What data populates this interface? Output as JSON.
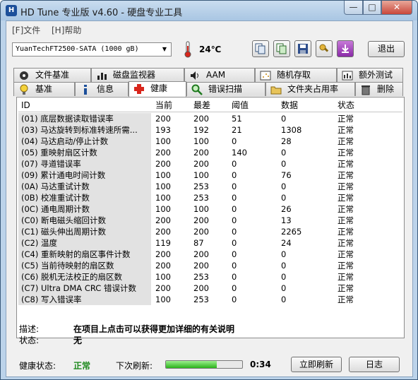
{
  "window": {
    "app_icon_text": "H",
    "title": "HD Tune 专业版 v4.60 - 硬盘专业工具",
    "controls": {
      "minimize": "—",
      "maximize": "□",
      "close": "✕"
    }
  },
  "menu": [
    {
      "label": "[F]文件"
    },
    {
      "label": "[H]帮助"
    }
  ],
  "toolbar": {
    "drive": "YuanTechFT2500-SATA          (1000 gB)",
    "temperature": "24℃",
    "buttons": [
      "copy-icon",
      "copy-info-icon",
      "save-icon",
      "options-icon",
      "download-icon"
    ],
    "exit_label": "退出"
  },
  "tabs_top": [
    {
      "label": "文件基准",
      "icon": "file-benchmark-icon"
    },
    {
      "label": "磁盘监视器",
      "icon": "disk-monitor-icon"
    },
    {
      "label": "AAM",
      "icon": "speaker-icon"
    },
    {
      "label": "随机存取",
      "icon": "random-access-icon"
    },
    {
      "label": "额外测试",
      "icon": "extra-tests-icon"
    }
  ],
  "tabs_bottom": [
    {
      "label": "基准",
      "icon": "bulb-icon"
    },
    {
      "label": "信息",
      "icon": "info-icon"
    },
    {
      "label": "健康",
      "icon": "health-cross-icon",
      "active": true
    },
    {
      "label": "错误扫描",
      "icon": "magnifier-icon"
    },
    {
      "label": "文件夹占用率",
      "icon": "folder-icon"
    },
    {
      "label": "删除",
      "icon": "trash-icon"
    }
  ],
  "table": {
    "headers": [
      "ID",
      "当前",
      "最差",
      "阈值",
      "数据",
      "状态"
    ],
    "rows": [
      {
        "id": "(01) 底层数据读取错误率",
        "current": "200",
        "worst": "200",
        "threshold": "51",
        "data": "0",
        "status": "正常"
      },
      {
        "id": "(03) 马达旋转到标准转速所需...",
        "current": "193",
        "worst": "192",
        "threshold": "21",
        "data": "1308",
        "status": "正常"
      },
      {
        "id": "(04) 马达启动/停止计数",
        "current": "100",
        "worst": "100",
        "threshold": "0",
        "data": "28",
        "status": "正常"
      },
      {
        "id": "(05) 重映射扇区计数",
        "current": "200",
        "worst": "200",
        "threshold": "140",
        "data": "0",
        "status": "正常"
      },
      {
        "id": "(07) 寻道错误率",
        "current": "200",
        "worst": "200",
        "threshold": "0",
        "data": "0",
        "status": "正常"
      },
      {
        "id": "(09) 累计通电时间计数",
        "current": "100",
        "worst": "100",
        "threshold": "0",
        "data": "76",
        "status": "正常"
      },
      {
        "id": "(0A) 马达重试计数",
        "current": "100",
        "worst": "253",
        "threshold": "0",
        "data": "0",
        "status": "正常"
      },
      {
        "id": "(0B) 校准重试计数",
        "current": "100",
        "worst": "253",
        "threshold": "0",
        "data": "0",
        "status": "正常"
      },
      {
        "id": "(0C) 通电周期计数",
        "current": "100",
        "worst": "100",
        "threshold": "0",
        "data": "26",
        "status": "正常"
      },
      {
        "id": "(C0) 断电磁头缩回计数",
        "current": "200",
        "worst": "200",
        "threshold": "0",
        "data": "13",
        "status": "正常"
      },
      {
        "id": "(C1) 磁头伸出周期计数",
        "current": "200",
        "worst": "200",
        "threshold": "0",
        "data": "2265",
        "status": "正常"
      },
      {
        "id": "(C2) 温度",
        "current": "119",
        "worst": "87",
        "threshold": "0",
        "data": "24",
        "status": "正常"
      },
      {
        "id": "(C4) 重新映射的扇区事件计数",
        "current": "200",
        "worst": "200",
        "threshold": "0",
        "data": "0",
        "status": "正常"
      },
      {
        "id": "(C5) 当前待映射的扇区数",
        "current": "200",
        "worst": "200",
        "threshold": "0",
        "data": "0",
        "status": "正常"
      },
      {
        "id": "(C6) 脱机无法校正的扇区数",
        "current": "100",
        "worst": "253",
        "threshold": "0",
        "data": "0",
        "status": "正常"
      },
      {
        "id": "(C7) Ultra DMA CRC 错误计数",
        "current": "200",
        "worst": "200",
        "threshold": "0",
        "data": "0",
        "status": "正常"
      },
      {
        "id": "(C8) 写入错误率",
        "current": "100",
        "worst": "253",
        "threshold": "0",
        "data": "0",
        "status": "正常"
      }
    ]
  },
  "description": {
    "label": "描述:",
    "value": "在项目上点击可以获得更加详细的有关说明",
    "status_label": "状态:",
    "status_value": "无"
  },
  "footer": {
    "health_label": "健康状态:",
    "health_value": "正常",
    "health_color": "#1e8a1e",
    "next_refresh_label": "下次刷新:",
    "progress_fraction": 0.67,
    "countdown": "0:34",
    "refresh_label": "立即刷新",
    "log_label": "日志"
  }
}
